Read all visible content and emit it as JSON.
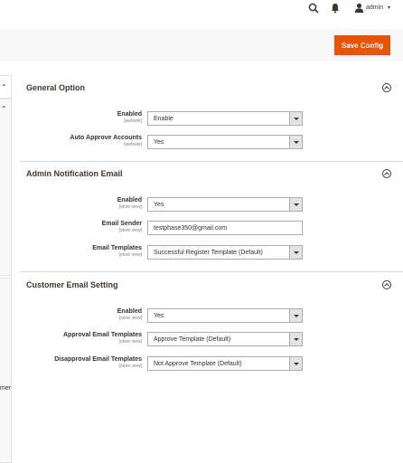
{
  "header": {
    "admin_label": "admin",
    "caret": "▾",
    "icons": [
      "search-icon",
      "bell-icon",
      "user-icon"
    ]
  },
  "action_bar": {
    "save_label": "Save Config",
    "accent": "#eb5202"
  },
  "sidebar": {
    "chev_down": "⌄",
    "chev_up": "⌃",
    "clipped_text": "mer"
  },
  "sections": {
    "general": {
      "title": "General Option",
      "fields": [
        {
          "label": "Enabled",
          "scope": "[website]",
          "value": "Enable"
        },
        {
          "label": "Auto Approve Accounts",
          "scope": "[website]",
          "value": "Yes"
        }
      ]
    },
    "admin_email": {
      "title": "Admin Notification Email",
      "fields": [
        {
          "label": "Enabled",
          "scope": "[store view]",
          "value": "Yes"
        },
        {
          "label": "Email Sender",
          "scope": "[store view]",
          "value": "testphase350@gmail.com"
        },
        {
          "label": "Email Templates",
          "scope": "[store view]",
          "value": "Successful Register Template (Default)"
        }
      ]
    },
    "customer_email": {
      "title": "Customer Email Setting",
      "fields": [
        {
          "label": "Enabled",
          "scope": "[store view]",
          "value": "Yes"
        },
        {
          "label": "Approval Email Templates",
          "scope": "[store view]",
          "value": "Approve Template (Default)"
        },
        {
          "label": "Disapproval Email Templates",
          "scope": "[store view]",
          "value": "Not Approve Template (Default)"
        }
      ]
    }
  }
}
